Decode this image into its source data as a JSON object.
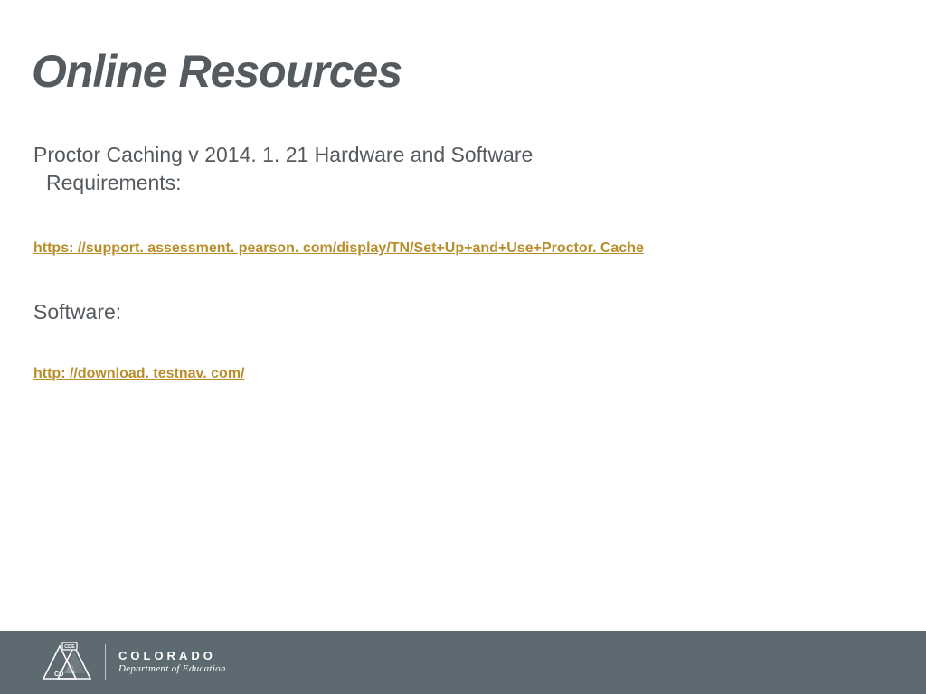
{
  "title": "Online Resources",
  "section1": {
    "heading_line1": "Proctor Caching v 2014. 1. 21 Hardware and Software",
    "heading_line2": "Requirements:",
    "link_text": "https: //support. assessment. pearson. com/display/TN/Set+Up+and+Use+Proctor. Cache"
  },
  "section2": {
    "heading": "Software:",
    "link_text": "http: //download. testnav. com/"
  },
  "footer": {
    "logo_badge": "CDE",
    "state_abbrev": "CO",
    "brand_line1": "COLORADO",
    "brand_line2": "Department of Education"
  },
  "colors": {
    "heading": "#555a5f",
    "link": "#b98d2a",
    "footer_bg": "#5e6a71"
  }
}
